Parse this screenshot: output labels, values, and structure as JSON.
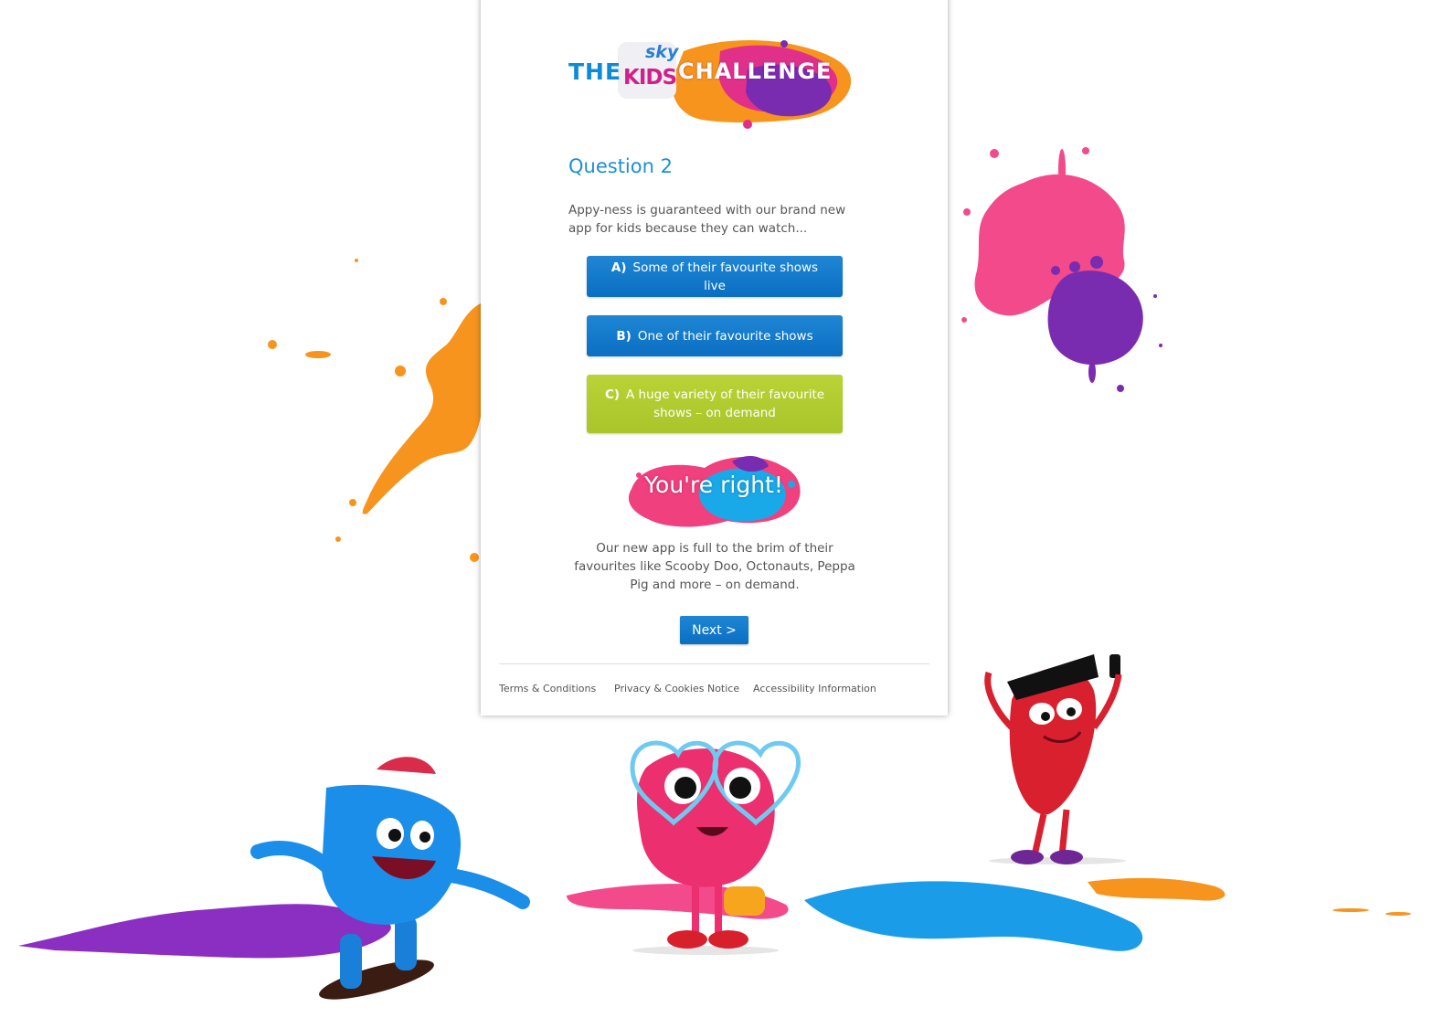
{
  "logo": {
    "the": "THE",
    "sky": "sky",
    "kids": "KIDS",
    "challenge": "CHALLENGE"
  },
  "question": {
    "title": "Question 2",
    "text": "Appy-ness is guaranteed with our brand new app for kids because they can watch..."
  },
  "answers": [
    {
      "letter": "A)",
      "text": "Some of their favourite shows live"
    },
    {
      "letter": "B)",
      "text": "One of their favourite shows"
    },
    {
      "letter": "C)",
      "text": "A huge variety of their favourite shows – on demand"
    }
  ],
  "result": {
    "title": "You're right!",
    "text": "Our new app is full to the brim of their favourites like Scooby Doo, Octonauts, Peppa Pig and more – on demand."
  },
  "next_button": "Next >",
  "footer": {
    "terms": "Terms & Conditions",
    "privacy": "Privacy & Cookies Notice",
    "accessibility": "Accessibility Information"
  },
  "colors": {
    "accent_blue": "#0a6ec2",
    "title_blue": "#1c8fd8",
    "correct_green": "#b0ca2e",
    "splash_pink": "#f0407e",
    "splash_purple": "#7a2cb0",
    "splash_orange": "#f7941d",
    "splash_cyan": "#1aa9e8"
  },
  "icons": [
    "blue-skater-character",
    "pink-heart-glasses-character",
    "red-sunglasses-character"
  ]
}
